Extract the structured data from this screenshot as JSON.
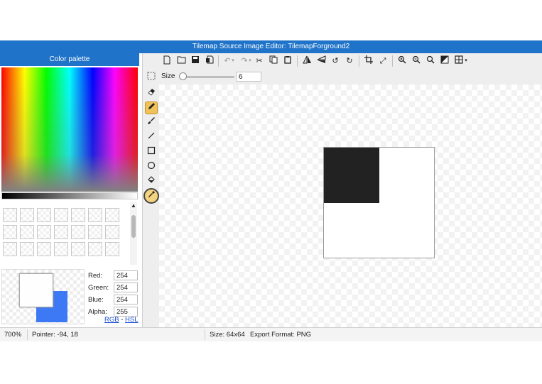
{
  "window": {
    "title": "Tilemap Source Image Editor: TilemapForground2"
  },
  "palette": {
    "header": "Color palette",
    "swatch_count": 21,
    "preview": {
      "primary_color": "#fefefe",
      "secondary_color": "#3d78f5"
    },
    "rgba": [
      {
        "label": "Red:",
        "value": "254"
      },
      {
        "label": "Green:",
        "value": "254"
      },
      {
        "label": "Blue:",
        "value": "254"
      },
      {
        "label": "Alpha:",
        "value": "255"
      }
    ],
    "mode_rgb": "RGB",
    "mode_sep": "-",
    "mode_hsl": "HSL"
  },
  "tools": [
    {
      "name": "marquee-select-icon",
      "active": false
    },
    {
      "name": "eraser-icon",
      "active": false
    },
    {
      "name": "pencil-icon",
      "active": true
    },
    {
      "name": "brush-icon",
      "active": false
    },
    {
      "name": "line-icon",
      "active": false
    },
    {
      "name": "rectangle-icon",
      "active": false
    },
    {
      "name": "circle-icon",
      "active": false
    },
    {
      "name": "fill-bucket-icon",
      "active": false
    },
    {
      "name": "color-picker-icon",
      "active": false,
      "highlighted": true
    }
  ],
  "toolbar": {
    "buttons": [
      "new-file-icon",
      "open-folder-icon",
      "save-icon",
      "save-as-icon",
      "undo-icon",
      "redo-icon",
      "cut-icon",
      "copy-icon",
      "paste-icon",
      "flip-horizontal-icon",
      "flip-vertical-icon",
      "rotate-left-icon",
      "rotate-right-icon",
      "crop-icon",
      "resize-icon",
      "zoom-in-icon",
      "zoom-out-icon",
      "zoom-fit-icon",
      "toggle-transparency-icon",
      "grid-icon"
    ]
  },
  "size_bar": {
    "label": "Size",
    "value": "6",
    "level_fraction": 0.0
  },
  "canvas": {
    "fill_color": "#222222"
  },
  "status": {
    "zoom": "700%",
    "pointer": "Pointer: -94, 18",
    "size": "Size: 64x64",
    "export": "Export Format: PNG"
  }
}
